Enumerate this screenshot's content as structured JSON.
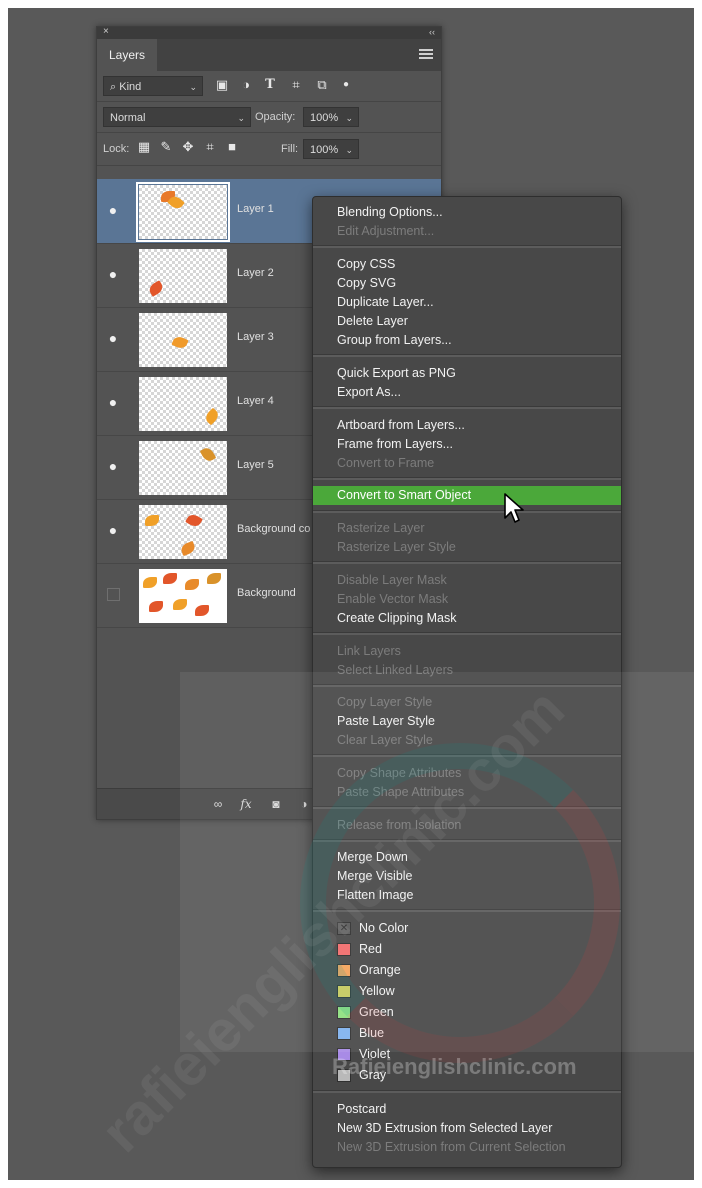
{
  "panel": {
    "close_glyph": "×",
    "collapse_glyph": "‹‹",
    "tab_label": "Layers",
    "filter": {
      "label": "Kind"
    },
    "blend_mode": "Normal",
    "opacity_label": "Opacity:",
    "opacity_value": "100%",
    "lock_label": "Lock:",
    "fill_label": "Fill:",
    "fill_value": "100%",
    "layers": [
      {
        "name": "Layer 1",
        "visible": true,
        "selected": true
      },
      {
        "name": "Layer 2",
        "visible": true
      },
      {
        "name": "Layer 3",
        "visible": true
      },
      {
        "name": "Layer 4",
        "visible": true
      },
      {
        "name": "Layer 5",
        "visible": true
      },
      {
        "name": "Background co",
        "visible": true
      },
      {
        "name": "Background",
        "visible": false
      }
    ],
    "footer_icons": [
      "link-icon",
      "fx-icon",
      "mask-icon",
      "adjustment-icon"
    ],
    "footer_fx": "fx"
  },
  "context_menu": {
    "items": [
      {
        "label": "Blending Options...",
        "enabled": true
      },
      {
        "label": "Edit Adjustment...",
        "enabled": false
      },
      {
        "label": "Copy CSS",
        "enabled": true
      },
      {
        "label": "Copy SVG",
        "enabled": true
      },
      {
        "label": "Duplicate Layer...",
        "enabled": true
      },
      {
        "label": "Delete Layer",
        "enabled": true
      },
      {
        "label": "Group from Layers...",
        "enabled": true
      },
      {
        "label": "Quick Export as PNG",
        "enabled": true
      },
      {
        "label": "Export As...",
        "enabled": true
      },
      {
        "label": "Artboard from Layers...",
        "enabled": true
      },
      {
        "label": "Frame from Layers...",
        "enabled": true
      },
      {
        "label": "Convert to Frame",
        "enabled": false
      },
      {
        "label": "Convert to Smart Object",
        "enabled": true,
        "highlighted": true
      },
      {
        "label": "Rasterize Layer",
        "enabled": false
      },
      {
        "label": "Rasterize Layer Style",
        "enabled": false
      },
      {
        "label": "Disable Layer Mask",
        "enabled": false
      },
      {
        "label": "Enable Vector Mask",
        "enabled": false
      },
      {
        "label": "Create Clipping Mask",
        "enabled": true
      },
      {
        "label": "Link Layers",
        "enabled": false
      },
      {
        "label": "Select Linked Layers",
        "enabled": false
      },
      {
        "label": "Copy Layer Style",
        "enabled": false
      },
      {
        "label": "Paste Layer Style",
        "enabled": true
      },
      {
        "label": "Clear Layer Style",
        "enabled": false
      },
      {
        "label": "Copy Shape Attributes",
        "enabled": false
      },
      {
        "label": "Paste Shape Attributes",
        "enabled": false
      },
      {
        "label": "Release from Isolation",
        "enabled": false
      },
      {
        "label": "Merge Down",
        "enabled": true
      },
      {
        "label": "Merge Visible",
        "enabled": true
      },
      {
        "label": "Flatten Image",
        "enabled": true
      },
      {
        "label": "No Color",
        "enabled": true,
        "color": "none"
      },
      {
        "label": "Red",
        "enabled": true,
        "color": "#f26c6c"
      },
      {
        "label": "Orange",
        "enabled": true,
        "color": "#f5a35b"
      },
      {
        "label": "Yellow",
        "enabled": true,
        "color": "#e8d65a"
      },
      {
        "label": "Green",
        "enabled": true,
        "color": "#8fe07f"
      },
      {
        "label": "Blue",
        "enabled": true,
        "color": "#7fb2ee"
      },
      {
        "label": "Violet",
        "enabled": true,
        "color": "#a88be6"
      },
      {
        "label": "Gray",
        "enabled": true,
        "color": "#b9b9b9"
      },
      {
        "label": "Postcard",
        "enabled": true
      },
      {
        "label": "New 3D Extrusion from Selected Layer",
        "enabled": true
      },
      {
        "label": "New 3D Extrusion from Current Selection",
        "enabled": false
      }
    ]
  },
  "watermark": {
    "text": "Rafieienglishclinic.com",
    "diagonal": "rafieienglishclinic.com"
  }
}
